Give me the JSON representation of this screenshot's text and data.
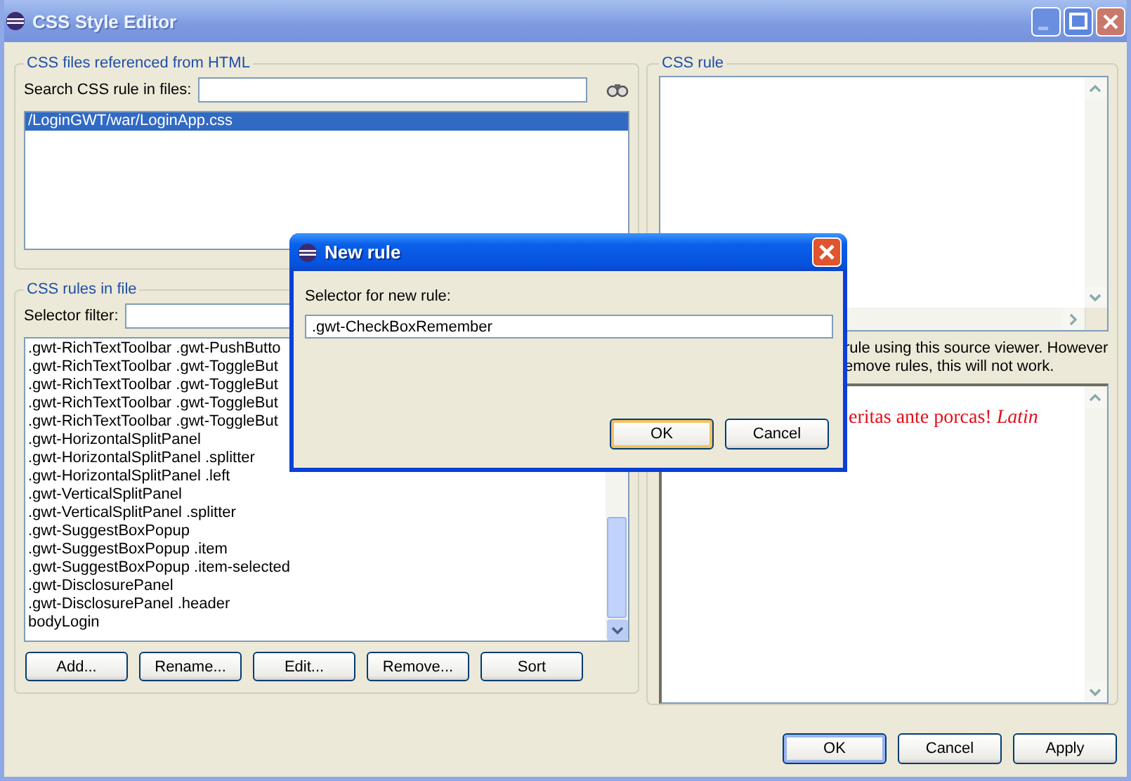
{
  "window": {
    "title": "CSS Style Editor"
  },
  "files_group": {
    "title": "CSS files referenced from HTML",
    "search_label": "Search CSS rule in files:",
    "files": [
      {
        "name": "/LoginGWT/war/LoginApp.css",
        "selected": true
      }
    ]
  },
  "rules_group": {
    "title": "CSS rules in file",
    "filter_label": "Selector filter:",
    "rules": [
      {
        "text": ".gwt-RichTextToolbar .gwt-PushButto",
        "selected": false
      },
      {
        "text": ".gwt-RichTextToolbar .gwt-ToggleBut",
        "selected": false
      },
      {
        "text": ".gwt-RichTextToolbar .gwt-ToggleBut",
        "selected": false
      },
      {
        "text": ".gwt-RichTextToolbar .gwt-ToggleBut",
        "selected": false
      },
      {
        "text": ".gwt-RichTextToolbar .gwt-ToggleBut",
        "selected": false
      },
      {
        "text": ".gwt-HorizontalSplitPanel",
        "selected": false
      },
      {
        "text": ".gwt-HorizontalSplitPanel .splitter",
        "selected": false
      },
      {
        "text": ".gwt-HorizontalSplitPanel .left",
        "selected": false
      },
      {
        "text": ".gwt-VerticalSplitPanel",
        "selected": false
      },
      {
        "text": ".gwt-VerticalSplitPanel .splitter",
        "selected": false
      },
      {
        "text": ".gwt-SuggestBoxPopup",
        "selected": false
      },
      {
        "text": ".gwt-SuggestBoxPopup .item",
        "selected": false
      },
      {
        "text": ".gwt-SuggestBoxPopup .item-selected",
        "selected": false
      },
      {
        "text": ".gwt-DisclosurePanel",
        "selected": false
      },
      {
        "text": ".gwt-DisclosurePanel .header",
        "selected": false
      },
      {
        "text": "bodyLogin",
        "selected": false
      }
    ],
    "buttons": [
      "Add...",
      "Rename...",
      "Edit...",
      "Remove...",
      "Sort"
    ]
  },
  "rule_group": {
    "title": "CSS rule",
    "message": [
      "rule using this source viewer. However",
      "emove rules, this will not work."
    ],
    "preview": "eritas ante porcas! *Latin*"
  },
  "dialog": {
    "title": "New rule",
    "label": "Selector for new rule:",
    "value": ".gwt-CheckBoxRemember",
    "buttons": [
      {
        "label": "OK",
        "default": true
      },
      {
        "label": "Cancel",
        "default": false
      }
    ]
  },
  "footer_buttons": [
    {
      "label": "OK",
      "default": true
    },
    {
      "label": "Cancel",
      "default": false
    },
    {
      "label": "Apply",
      "default": false
    }
  ]
}
